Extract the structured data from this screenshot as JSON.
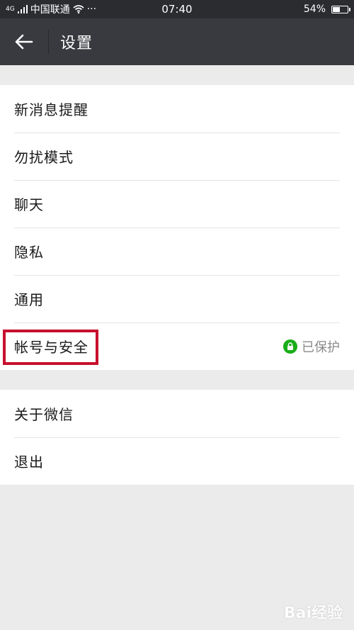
{
  "status_bar": {
    "network": "4G",
    "carrier": "中国联通",
    "more": "···",
    "time": "07:40",
    "battery_percent": "54%",
    "battery_level": 0.54
  },
  "header": {
    "title": "设置",
    "back_icon": "arrow-left-icon"
  },
  "groups": [
    {
      "items": [
        {
          "label": "新消息提醒"
        },
        {
          "label": "勿扰模式"
        },
        {
          "label": "聊天"
        },
        {
          "label": "隐私"
        },
        {
          "label": "通用"
        },
        {
          "label": "帐号与安全",
          "status": "已保护",
          "status_icon": "lock-icon",
          "highlighted": true
        }
      ]
    },
    {
      "items": [
        {
          "label": "关于微信"
        },
        {
          "label": "退出"
        }
      ]
    }
  ],
  "colors": {
    "status_bar_bg": "#2b2c30",
    "header_bg": "#393a3f",
    "page_bg": "#ebebeb",
    "protected_green": "#1aad19",
    "highlight_red": "#c8102e"
  },
  "watermark": "Bai经验"
}
